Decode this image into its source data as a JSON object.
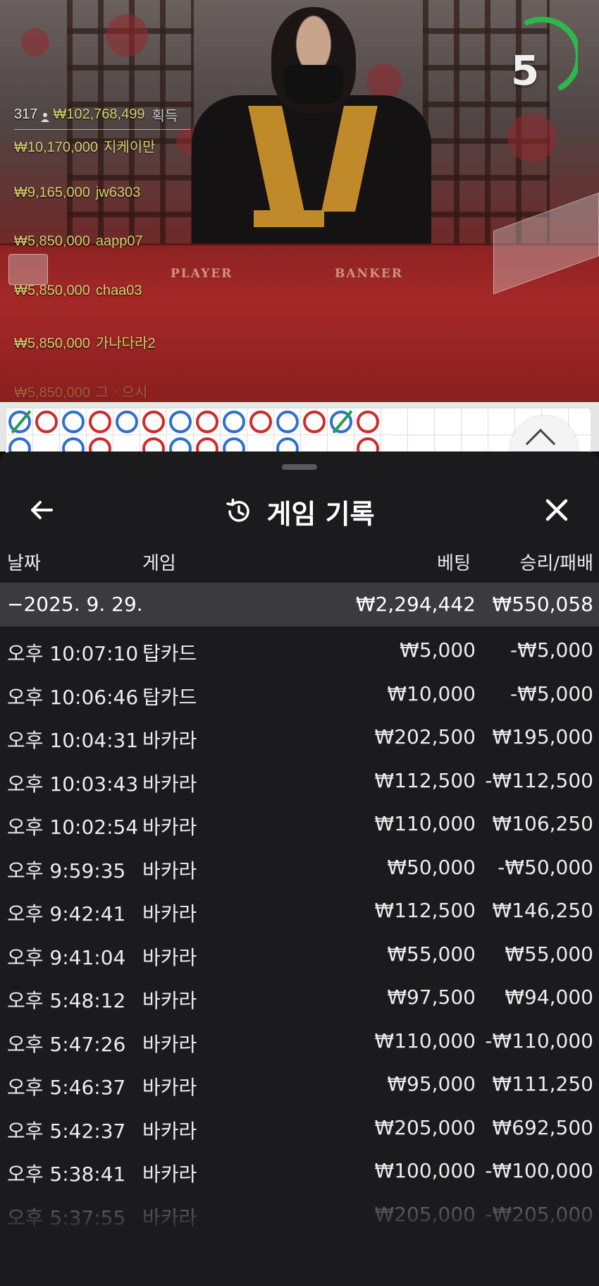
{
  "video": {
    "countdown": "5",
    "table_labels": {
      "player": "PLAYER",
      "banker": "BANKER"
    },
    "winners_header": {
      "count": "317",
      "total": "₩102,768,499",
      "suffix": "획득"
    },
    "winners": [
      {
        "amount": "₩10,170,000",
        "name": "지케이만"
      },
      {
        "amount": "₩9,165,000",
        "name": "jw6303"
      },
      {
        "amount": "₩5,850,000",
        "name": "aapp07"
      },
      {
        "amount": "₩5,850,000",
        "name": "chaa03"
      },
      {
        "amount": "₩5,850,000",
        "name": "가나다라2"
      },
      {
        "amount": "₩5,850,000",
        "name": "그ㆍ으시"
      }
    ]
  },
  "sheet": {
    "title": "게임 기록",
    "columns": {
      "date": "날짜",
      "game": "게임",
      "bet": "베팅",
      "result": "승리/패배"
    },
    "summary": {
      "date": "−2025. 9. 29.",
      "bet": "₩2,294,442",
      "result": "₩550,058"
    },
    "rows": [
      {
        "time": "오후 10:07:10",
        "game": "탑카드",
        "bet": "₩5,000",
        "result": "-₩5,000"
      },
      {
        "time": "오후 10:06:46",
        "game": "탑카드",
        "bet": "₩10,000",
        "result": "-₩5,000"
      },
      {
        "time": "오후 10:04:31",
        "game": "바카라",
        "bet": "₩202,500",
        "result": "₩195,000"
      },
      {
        "time": "오후 10:03:43",
        "game": "바카라",
        "bet": "₩112,500",
        "result": "-₩112,500"
      },
      {
        "time": "오후 10:02:54",
        "game": "바카라",
        "bet": "₩110,000",
        "result": "₩106,250"
      },
      {
        "time": "오후 9:59:35",
        "game": "바카라",
        "bet": "₩50,000",
        "result": "-₩50,000"
      },
      {
        "time": "오후 9:42:41",
        "game": "바카라",
        "bet": "₩112,500",
        "result": "₩146,250"
      },
      {
        "time": "오후 9:41:04",
        "game": "바카라",
        "bet": "₩55,000",
        "result": "₩55,000"
      },
      {
        "time": "오후 5:48:12",
        "game": "바카라",
        "bet": "₩97,500",
        "result": "₩94,000"
      },
      {
        "time": "오후 5:47:26",
        "game": "바카라",
        "bet": "₩110,000",
        "result": "-₩110,000"
      },
      {
        "time": "오후 5:46:37",
        "game": "바카라",
        "bet": "₩95,000",
        "result": "₩111,250"
      },
      {
        "time": "오후 5:42:37",
        "game": "바카라",
        "bet": "₩205,000",
        "result": "₩692,500"
      },
      {
        "time": "오후 5:38:41",
        "game": "바카라",
        "bet": "₩100,000",
        "result": "-₩100,000"
      },
      {
        "time": "오후 5:37:55",
        "game": "바카라",
        "bet": "₩205,000",
        "result": "-₩205,000"
      }
    ]
  },
  "colors": {
    "player": "#2e6fd1",
    "banker": "#d02a2a",
    "tie": "#1fa04a",
    "timer": "#2fb84a",
    "winner_gold": "#d9cf6f"
  },
  "icons": {
    "back": "arrow-left-icon",
    "history": "history-clock-icon",
    "close": "close-x-icon",
    "expand": "chevron-up-icon",
    "user": "user-icon"
  }
}
